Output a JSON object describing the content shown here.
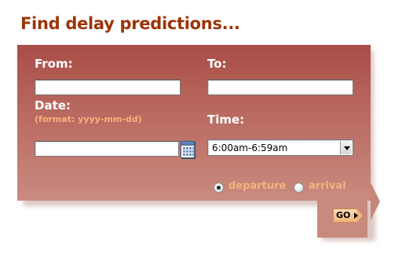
{
  "heading": "Find delay predictions...",
  "form": {
    "from_label": "From:",
    "from_value": "",
    "to_label": "To:",
    "to_value": "",
    "date_label": "Date:",
    "date_hint": "(format: yyyy-mm-dd)",
    "date_value": "",
    "time_label": "Time:",
    "time_selected": "6:00am-6:59am",
    "trip_type_options": [
      "departure",
      "arrival"
    ],
    "trip_type_selected": "departure",
    "go_label": "GO"
  },
  "icons": {
    "calendar": "calendar-icon",
    "go_arrow": "triangle-right-icon",
    "dropdown": "chevron-down-icon"
  },
  "colors": {
    "heading": "#9c3408",
    "panel_top": "#a94d46",
    "panel_bottom": "#c98b80",
    "label": "#ffffff",
    "accent_text": "#f5b27e",
    "go_button": "#f3b277"
  }
}
